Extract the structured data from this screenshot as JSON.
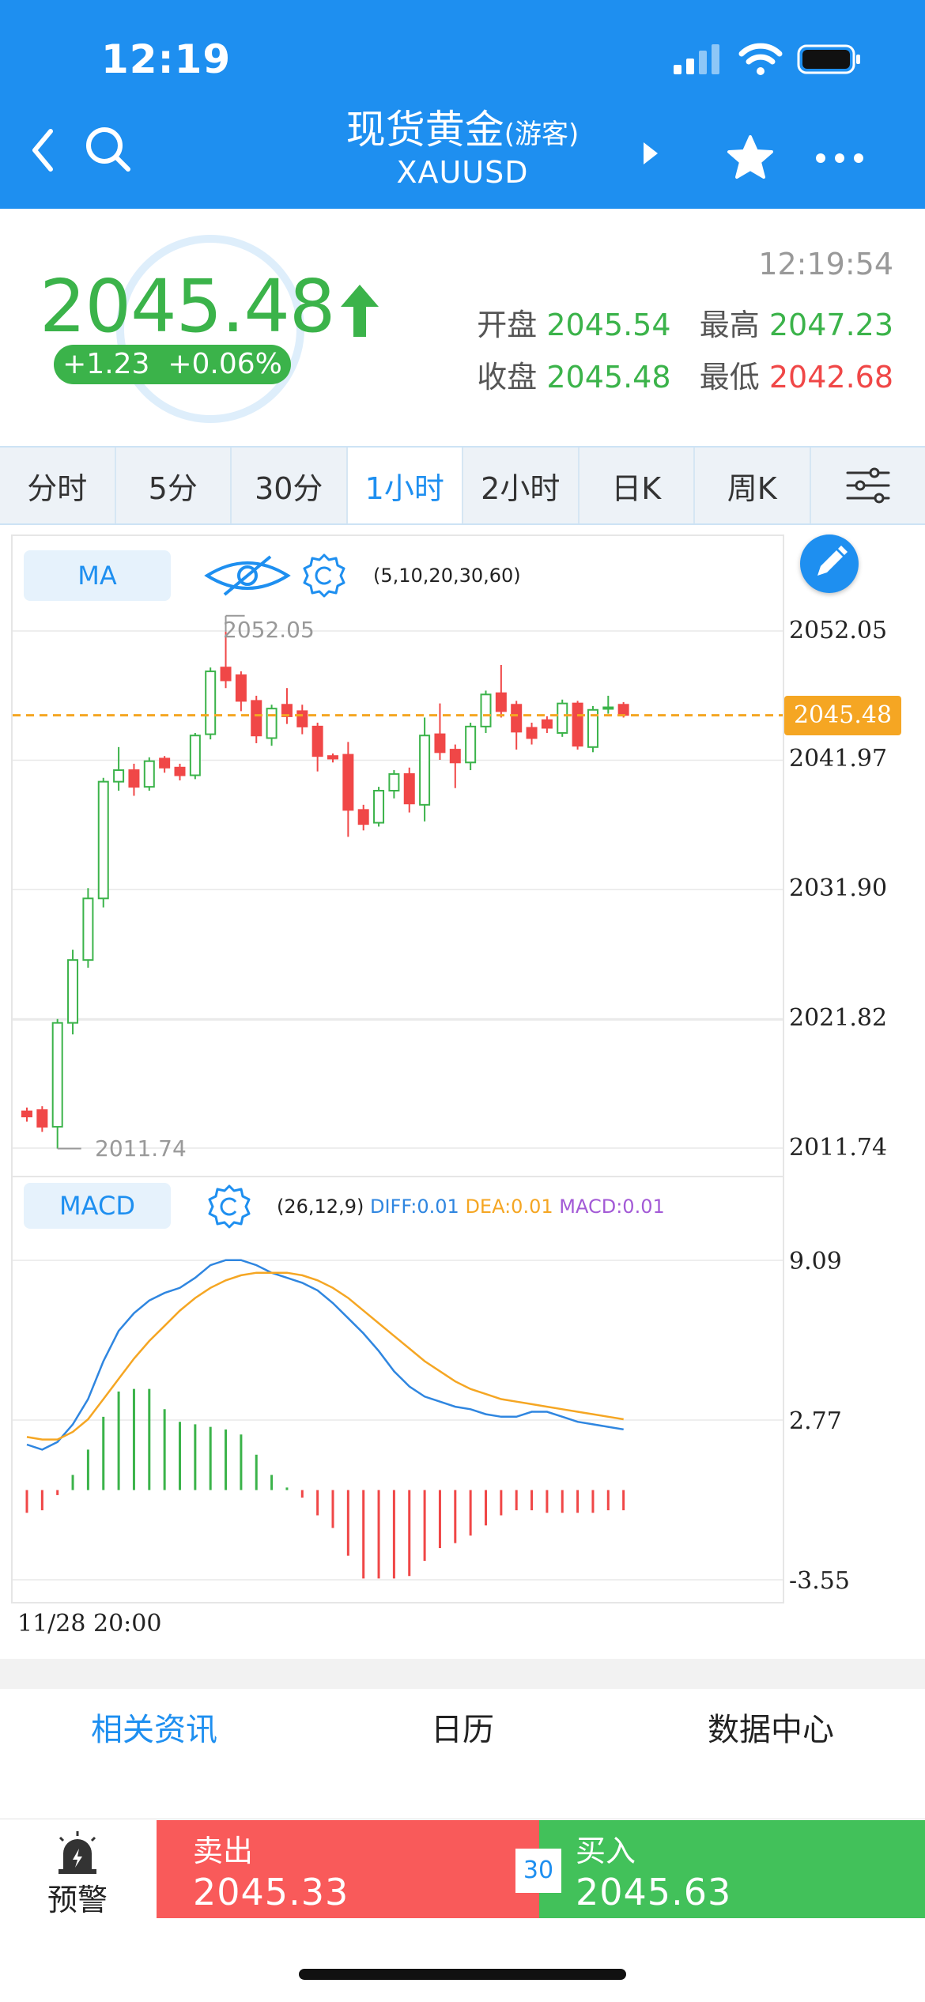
{
  "status_bar": {
    "time": "12:19"
  },
  "header": {
    "title": "现货黄金",
    "guest_tag": "(游客)",
    "symbol": "XAUUSD"
  },
  "quote": {
    "price": "2045.48",
    "change": "+1.23",
    "change_pct": "+0.06%",
    "time": "12:19:54",
    "open_label": "开盘",
    "open": "2045.54",
    "high_label": "最高",
    "high": "2047.23",
    "close_label": "收盘",
    "close": "2045.48",
    "low_label": "最低",
    "low": "2042.68"
  },
  "tabs": [
    {
      "label": "分时"
    },
    {
      "label": "5分"
    },
    {
      "label": "30分"
    },
    {
      "label": "1小时"
    },
    {
      "label": "2小时"
    },
    {
      "label": "日K"
    },
    {
      "label": "周K"
    }
  ],
  "active_tab": "1小时",
  "indicator": {
    "ma_label": "MA",
    "ma_params": "(5,10,20,30,60)",
    "macd_label": "MACD",
    "macd_params": "(26,12,9)",
    "diff": "DIFF:0.01",
    "dea": "DEA:0.01",
    "macd": "MACD:0.01"
  },
  "colors": {
    "up": "#3bb34a",
    "down": "#f04747",
    "accent": "#1e8ff0",
    "diff": "#2f86e0",
    "dea": "#f5a623",
    "macd": "#a35ad6"
  },
  "chart_data": {
    "type": "candlestick",
    "interval": "1小时",
    "price_axis": {
      "ticks": [
        "2052.05",
        "2041.97",
        "2031.90",
        "2021.82",
        "2011.74"
      ],
      "ylim": [
        2011.74,
        2052.05
      ]
    },
    "current_price": "2045.48",
    "max_label": "2052.05",
    "min_label": "2011.74",
    "start_date": "11/28 20:00",
    "candles": [
      {
        "o": 2014.6,
        "c": 2014.2,
        "h": 2014.9,
        "l": 2013.8
      },
      {
        "o": 2014.7,
        "c": 2013.4,
        "h": 2015.0,
        "l": 2013.0
      },
      {
        "o": 2013.4,
        "c": 2021.5,
        "h": 2021.8,
        "l": 2011.7
      },
      {
        "o": 2021.5,
        "c": 2026.4,
        "h": 2027.2,
        "l": 2020.6
      },
      {
        "o": 2026.4,
        "c": 2031.2,
        "h": 2032.0,
        "l": 2025.8
      },
      {
        "o": 2031.2,
        "c": 2040.3,
        "h": 2040.6,
        "l": 2030.5
      },
      {
        "o": 2040.3,
        "c": 2041.2,
        "h": 2043.0,
        "l": 2039.6
      },
      {
        "o": 2041.2,
        "c": 2039.9,
        "h": 2041.7,
        "l": 2039.2
      },
      {
        "o": 2039.9,
        "c": 2041.9,
        "h": 2042.2,
        "l": 2039.6
      },
      {
        "o": 2042.1,
        "c": 2041.4,
        "h": 2042.3,
        "l": 2041.0
      },
      {
        "o": 2041.4,
        "c": 2040.8,
        "h": 2041.7,
        "l": 2040.4
      },
      {
        "o": 2040.8,
        "c": 2043.9,
        "h": 2044.1,
        "l": 2040.5
      },
      {
        "o": 2044.0,
        "c": 2048.9,
        "h": 2049.2,
        "l": 2043.6
      },
      {
        "o": 2049.2,
        "c": 2048.2,
        "h": 2052.0,
        "l": 2047.6
      },
      {
        "o": 2048.6,
        "c": 2046.6,
        "h": 2048.9,
        "l": 2045.8
      },
      {
        "o": 2046.6,
        "c": 2043.9,
        "h": 2047.0,
        "l": 2043.3
      },
      {
        "o": 2043.7,
        "c": 2046.0,
        "h": 2046.3,
        "l": 2043.1
      },
      {
        "o": 2046.3,
        "c": 2045.4,
        "h": 2047.6,
        "l": 2044.8
      },
      {
        "o": 2045.8,
        "c": 2044.6,
        "h": 2046.3,
        "l": 2044.0
      },
      {
        "o": 2044.6,
        "c": 2042.3,
        "h": 2044.9,
        "l": 2041.1
      },
      {
        "o": 2042.3,
        "c": 2042.1,
        "h": 2042.5,
        "l": 2041.8
      },
      {
        "o": 2042.4,
        "c": 2038.1,
        "h": 2043.4,
        "l": 2036.0
      },
      {
        "o": 2038.1,
        "c": 2037.0,
        "h": 2038.5,
        "l": 2036.5
      },
      {
        "o": 2037.1,
        "c": 2039.6,
        "h": 2039.9,
        "l": 2036.8
      },
      {
        "o": 2039.6,
        "c": 2040.9,
        "h": 2041.2,
        "l": 2039.0
      },
      {
        "o": 2040.9,
        "c": 2038.6,
        "h": 2041.4,
        "l": 2037.9
      },
      {
        "o": 2038.5,
        "c": 2043.9,
        "h": 2045.3,
        "l": 2037.2
      },
      {
        "o": 2044.0,
        "c": 2042.6,
        "h": 2046.4,
        "l": 2042.0
      },
      {
        "o": 2042.8,
        "c": 2041.8,
        "h": 2043.2,
        "l": 2039.8
      },
      {
        "o": 2041.8,
        "c": 2044.6,
        "h": 2044.9,
        "l": 2041.2
      },
      {
        "o": 2044.6,
        "c": 2047.1,
        "h": 2047.4,
        "l": 2044.1
      },
      {
        "o": 2047.2,
        "c": 2045.8,
        "h": 2049.4,
        "l": 2045.3
      },
      {
        "o": 2046.3,
        "c": 2044.2,
        "h": 2046.6,
        "l": 2042.8
      },
      {
        "o": 2044.5,
        "c": 2043.7,
        "h": 2044.9,
        "l": 2043.2
      },
      {
        "o": 2045.1,
        "c": 2044.5,
        "h": 2045.4,
        "l": 2044.1
      },
      {
        "o": 2044.1,
        "c": 2046.4,
        "h": 2046.7,
        "l": 2043.8
      },
      {
        "o": 2046.4,
        "c": 2043.1,
        "h": 2046.6,
        "l": 2042.8
      },
      {
        "o": 2043.0,
        "c": 2045.9,
        "h": 2046.2,
        "l": 2042.6
      },
      {
        "o": 2046.0,
        "c": 2046.1,
        "h": 2047.0,
        "l": 2045.6
      },
      {
        "o": 2046.3,
        "c": 2045.5,
        "h": 2046.5,
        "l": 2045.3
      }
    ],
    "macd_axis": {
      "ticks": [
        "9.09",
        "2.77",
        "-3.55"
      ],
      "ylim": [
        -3.55,
        9.09
      ]
    },
    "diff": [
      1.8,
      1.6,
      1.9,
      2.6,
      3.6,
      5.1,
      6.3,
      7.0,
      7.5,
      7.8,
      8.0,
      8.4,
      8.9,
      9.1,
      9.1,
      8.9,
      8.6,
      8.4,
      8.2,
      7.9,
      7.4,
      6.8,
      6.2,
      5.5,
      4.7,
      4.1,
      3.7,
      3.5,
      3.3,
      3.2,
      3.0,
      2.9,
      2.9,
      3.1,
      3.1,
      2.9,
      2.7,
      2.6,
      2.5,
      2.4
    ],
    "dea": [
      2.1,
      2.0,
      2.0,
      2.3,
      2.8,
      3.6,
      4.4,
      5.2,
      5.9,
      6.5,
      7.1,
      7.6,
      8.0,
      8.3,
      8.5,
      8.6,
      8.6,
      8.6,
      8.5,
      8.3,
      8.0,
      7.6,
      7.1,
      6.6,
      6.1,
      5.6,
      5.1,
      4.7,
      4.3,
      4.0,
      3.8,
      3.6,
      3.5,
      3.4,
      3.3,
      3.2,
      3.1,
      3.0,
      2.9,
      2.8
    ],
    "macd_hist": [
      -0.9,
      -0.8,
      -0.2,
      0.6,
      1.6,
      2.9,
      3.9,
      4.0,
      4.0,
      3.2,
      2.7,
      2.6,
      2.5,
      2.4,
      2.2,
      1.4,
      0.6,
      0.1,
      -0.3,
      -1.0,
      -1.5,
      -2.6,
      -3.5,
      -3.5,
      -3.5,
      -3.4,
      -2.8,
      -2.3,
      -2.1,
      -1.8,
      -1.4,
      -1.0,
      -0.8,
      -0.8,
      -0.9,
      -0.9,
      -0.9,
      -0.9,
      -0.8,
      -0.8
    ]
  },
  "info_tabs": {
    "news": "相关资讯",
    "calendar": "日历",
    "data_center": "数据中心"
  },
  "trade": {
    "alarm_label": "预警",
    "sell_label": "卖出",
    "sell_price": "2045.33",
    "spread": "30",
    "buy_label": "买入",
    "buy_price": "2045.63"
  }
}
